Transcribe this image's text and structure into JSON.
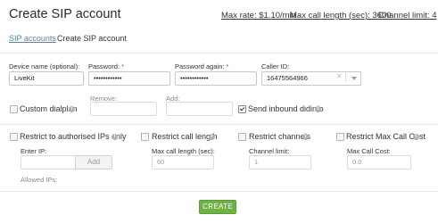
{
  "page": {
    "title": "Create SIP account",
    "max_rate": "Max rate: $1.10/min",
    "max_call_length": "Max call length (sec): 3600",
    "channel_limit": "Channel limit: 4"
  },
  "breadcrumb": {
    "parent": "SIP accounts",
    "current": "Create SIP account"
  },
  "form": {
    "device_name": {
      "label": "Device name (optional):",
      "value": "LiveKit"
    },
    "password": {
      "label": "Password:",
      "required_mark": "*",
      "value": "••••••••••••"
    },
    "password_again": {
      "label": "Password again:",
      "required_mark": "*",
      "value": "••••••••••••"
    },
    "caller_id": {
      "label": "Caller ID:",
      "value": "16475564966"
    },
    "custom_dialplan": {
      "label": "Custom dialplan",
      "checked": false
    },
    "dialplan_remove": {
      "label": "Remove:",
      "value": ""
    },
    "dialplan_add": {
      "label": "Add:",
      "value": ""
    },
    "send_inbound_didinfo": {
      "label": "Send inbound didinfo",
      "checked": true
    },
    "restrict_ips": {
      "label": "Restrict to authorised IPs only",
      "checked": false
    },
    "enter_ip": {
      "label": "Enter IP:",
      "value": ""
    },
    "add_button": "Add",
    "allowed_ips": {
      "label": "Allowed IPs:"
    },
    "restrict_call_length": {
      "label": "Restrict call length",
      "checked": false
    },
    "max_call_length": {
      "label": "Max call length (sec):",
      "placeholder": "60"
    },
    "restrict_channels": {
      "label": "Restrict channels",
      "checked": false
    },
    "channel_limit": {
      "label": "Channel limit:",
      "placeholder": "1"
    },
    "restrict_max_call_cost": {
      "label": "Restrict Max Call Cost",
      "checked": false
    },
    "max_call_cost": {
      "label": "Max Call Cost:",
      "placeholder": "0.0"
    },
    "create_button": "CREATE"
  },
  "icons": {
    "info": "info-icon",
    "clear": "close-icon",
    "caret": "chevron-down-icon"
  },
  "colors": {
    "link": "#3d8fb8",
    "create_button": "#6fb244",
    "required": "#d9342b",
    "info_icon": "#b0b0b0"
  }
}
